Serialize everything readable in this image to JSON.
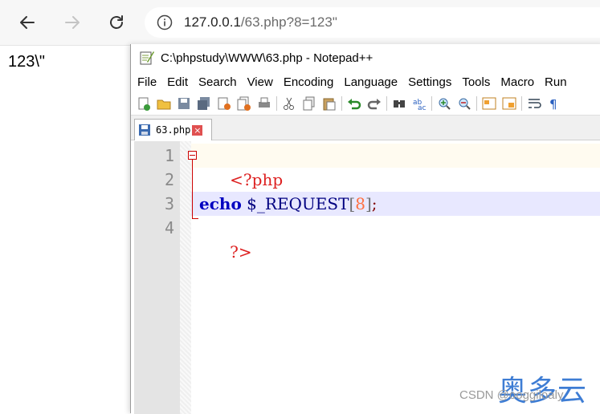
{
  "browser": {
    "url_host": "127.0.0.1",
    "url_rest": "/63.php?8=123\""
  },
  "page": {
    "output": "123\\\""
  },
  "notepad": {
    "title": "C:\\phpstudy\\WWW\\63.php - Notepad++",
    "menu": [
      "File",
      "Edit",
      "Search",
      "View",
      "Encoding",
      "Language",
      "Settings",
      "Tools",
      "Macro",
      "Run"
    ],
    "tab_label": "63.php",
    "tab_close": "×",
    "line_numbers": [
      "1",
      "2",
      "3",
      "4"
    ],
    "code": {
      "open_tag": "<?php",
      "keyword": "echo",
      "variable": "$_REQUEST",
      "bracket_open": "[",
      "index": "8",
      "bracket_close": "]",
      "semicolon": ";",
      "close_tag": "?>"
    },
    "current_line_color": "#e8e8ff",
    "first_line_color": "#fffbf0"
  },
  "watermark": {
    "csdn": "CSDN @ooggiloaly",
    "brand": "奥多云"
  }
}
